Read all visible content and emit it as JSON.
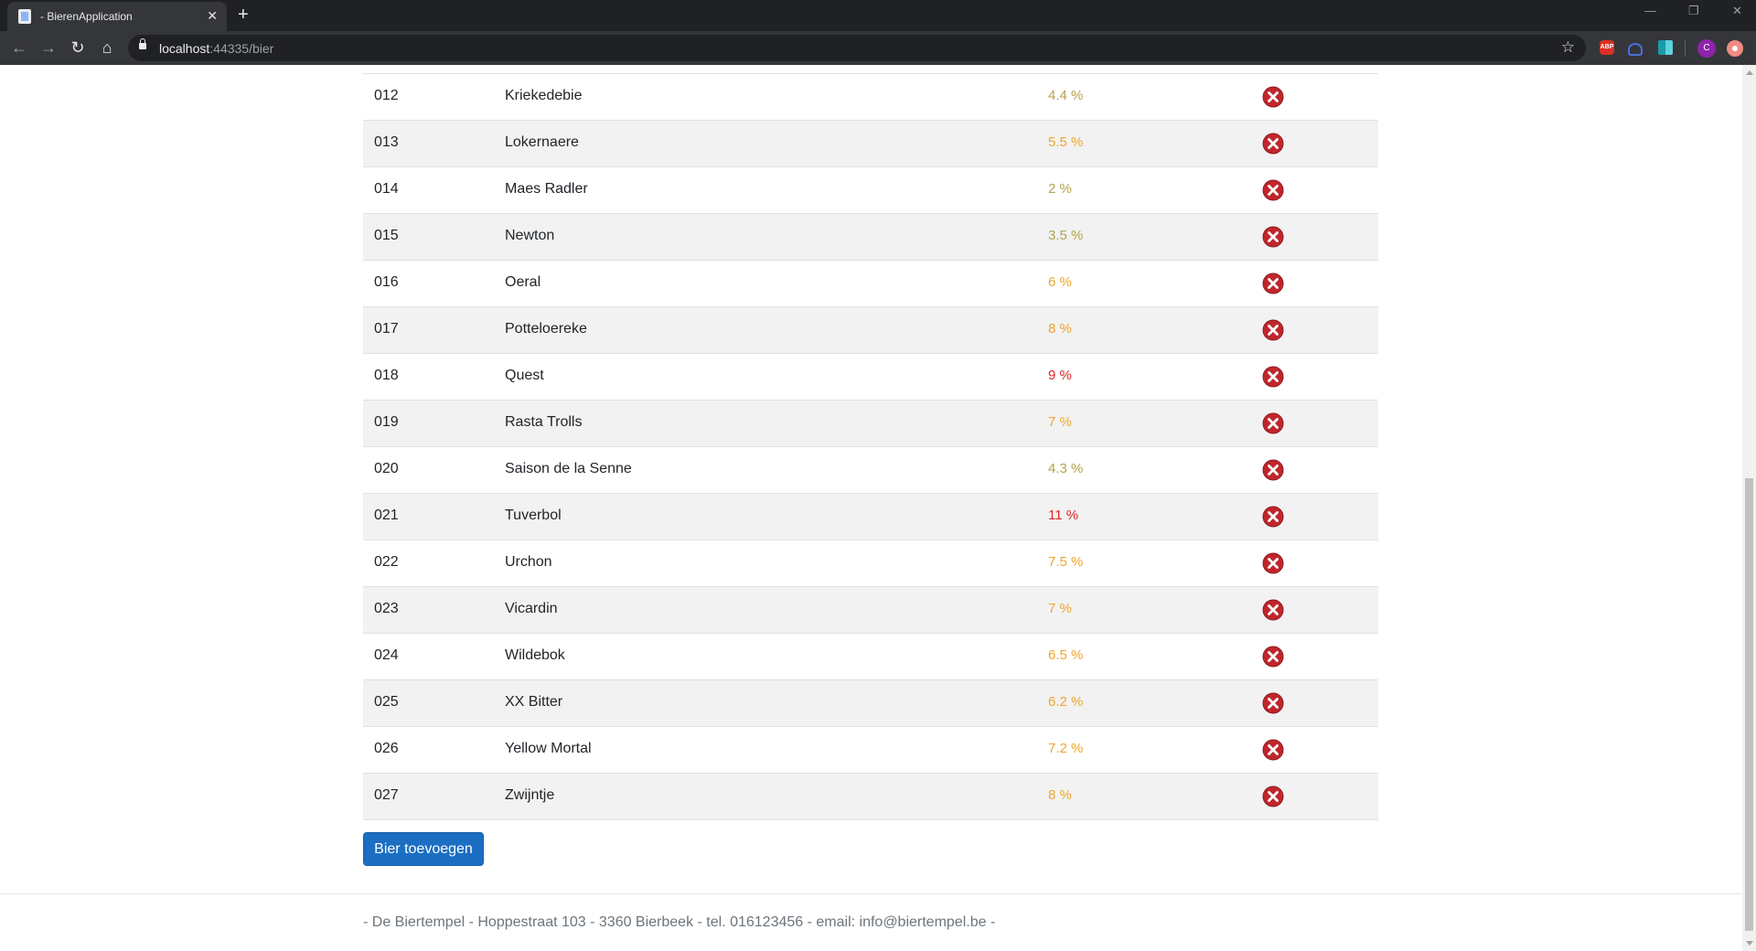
{
  "browser": {
    "tab_title": " - BierenApplication",
    "url_host": "localhost",
    "url_rest": ":44335/bier",
    "avatar_letter": "C",
    "abp_label": "ABP"
  },
  "colors": {
    "alcohol_low": "#b6a34b",
    "alcohol_mid": "#f0a52b",
    "alcohol_high": "#e02424",
    "delete_icon": "#c0262c",
    "button": "#1b6ec2"
  },
  "beers": [
    {
      "id": "012",
      "name": "Kriekedebie",
      "alcohol": "4.4 %",
      "level": "low"
    },
    {
      "id": "013",
      "name": "Lokernaere",
      "alcohol": "5.5 %",
      "level": "mid"
    },
    {
      "id": "014",
      "name": "Maes Radler",
      "alcohol": "2 %",
      "level": "low"
    },
    {
      "id": "015",
      "name": "Newton",
      "alcohol": "3.5 %",
      "level": "low"
    },
    {
      "id": "016",
      "name": "Oeral",
      "alcohol": "6 %",
      "level": "mid"
    },
    {
      "id": "017",
      "name": "Potteloereke",
      "alcohol": "8 %",
      "level": "mid"
    },
    {
      "id": "018",
      "name": "Quest",
      "alcohol": "9 %",
      "level": "high"
    },
    {
      "id": "019",
      "name": "Rasta Trolls",
      "alcohol": "7 %",
      "level": "mid"
    },
    {
      "id": "020",
      "name": "Saison de la Senne",
      "alcohol": "4.3 %",
      "level": "low"
    },
    {
      "id": "021",
      "name": "Tuverbol",
      "alcohol": "11 %",
      "level": "high"
    },
    {
      "id": "022",
      "name": "Urchon",
      "alcohol": "7.5 %",
      "level": "mid"
    },
    {
      "id": "023",
      "name": "Vicardin",
      "alcohol": "7 %",
      "level": "mid"
    },
    {
      "id": "024",
      "name": "Wildebok",
      "alcohol": "6.5 %",
      "level": "mid"
    },
    {
      "id": "025",
      "name": "XX Bitter",
      "alcohol": "6.2 %",
      "level": "mid"
    },
    {
      "id": "026",
      "name": "Yellow Mortal",
      "alcohol": "7.2 %",
      "level": "mid"
    },
    {
      "id": "027",
      "name": "Zwijntje",
      "alcohol": "8 %",
      "level": "mid"
    }
  ],
  "add_button_label": "Bier toevoegen",
  "footer_text": "- De Biertempel - Hoppestraat 103 - 3360 Bierbeek - tel. 016123456 - email: info@biertempel.be -"
}
